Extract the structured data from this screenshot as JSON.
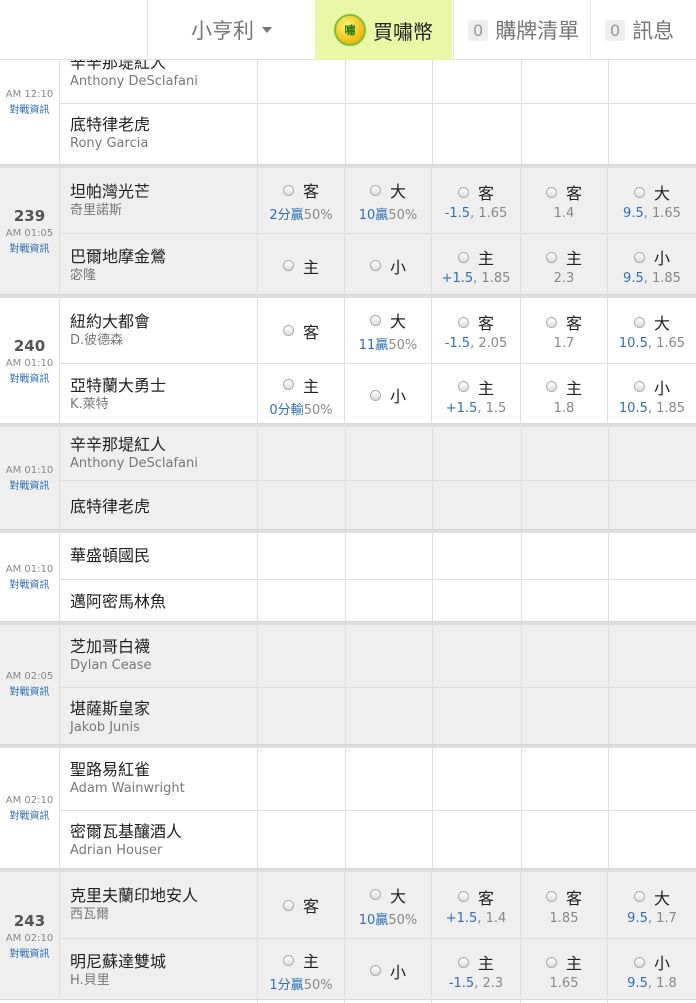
{
  "header": {
    "username": "小亨利",
    "coin_icon_text": "嘯",
    "buy_coin_label": "買嘯幣",
    "cart_count": "0",
    "cart_label": "購牌清單",
    "msg_count": "0",
    "msg_label": "訊息"
  },
  "games": [
    {
      "number": "",
      "time": "AM 12:10",
      "link": "對戰資訊",
      "gray": false,
      "clipped": true,
      "away": {
        "name": "辛辛那堤紅人",
        "sub": "Anthony DeSclafani"
      },
      "home": {
        "name": "底特律老虎",
        "sub": "Rony Garcia"
      },
      "odds": null
    },
    {
      "number": "239",
      "time": "AM 01:05",
      "link": "對戰資訊",
      "gray": true,
      "away": {
        "name": "坦帕灣光芒",
        "sub": "奇里諾斯"
      },
      "home": {
        "name": "巴爾地摩金鶯",
        "sub": "宓隆"
      },
      "odds": [
        {
          "away": {
            "label": "客",
            "hl": "2分贏",
            "rest": "50%"
          },
          "home": {
            "label": "主",
            "hl": "",
            "rest": ""
          }
        },
        {
          "away": {
            "label": "大",
            "hl": "10贏",
            "rest": "50%"
          },
          "home": {
            "label": "小",
            "hl": "",
            "rest": ""
          }
        },
        {
          "away": {
            "label": "客",
            "hl": "-1.5",
            "rest": ", 1.65"
          },
          "home": {
            "label": "主",
            "hl": "+1.5",
            "rest": ", 1.85"
          }
        },
        {
          "away": {
            "label": "客",
            "hl": "",
            "rest": "1.4"
          },
          "home": {
            "label": "主",
            "hl": "",
            "rest": "2.3"
          }
        },
        {
          "away": {
            "label": "大",
            "hl": "9.5",
            "rest": ", 1.65"
          },
          "home": {
            "label": "小",
            "hl": "9.5",
            "rest": ", 1.85"
          }
        }
      ]
    },
    {
      "number": "240",
      "time": "AM 01:10",
      "link": "對戰資訊",
      "gray": false,
      "away": {
        "name": "紐約大都會",
        "sub": "D.彼德森"
      },
      "home": {
        "name": "亞特蘭大勇士",
        "sub": "K.萊特"
      },
      "odds": [
        {
          "away": {
            "label": "客",
            "hl": "",
            "rest": ""
          },
          "home": {
            "label": "主",
            "hl": "0分輸",
            "rest": "50%"
          }
        },
        {
          "away": {
            "label": "大",
            "hl": "11贏",
            "rest": "50%"
          },
          "home": {
            "label": "小",
            "hl": "",
            "rest": ""
          }
        },
        {
          "away": {
            "label": "客",
            "hl": "-1.5",
            "rest": ", 2.05"
          },
          "home": {
            "label": "主",
            "hl": "+1.5",
            "rest": ", 1.5"
          }
        },
        {
          "away": {
            "label": "客",
            "hl": "",
            "rest": "1.7"
          },
          "home": {
            "label": "主",
            "hl": "",
            "rest": "1.8"
          }
        },
        {
          "away": {
            "label": "大",
            "hl": "10.5",
            "rest": ", 1.65"
          },
          "home": {
            "label": "小",
            "hl": "10.5",
            "rest": ", 1.85"
          }
        }
      ]
    },
    {
      "number": "",
      "time": "AM 01:10",
      "link": "對戰資訊",
      "gray": true,
      "away": {
        "name": "辛辛那堤紅人",
        "sub": "Anthony DeSclafani"
      },
      "home": {
        "name": "底特律老虎",
        "sub": ""
      },
      "odds": null
    },
    {
      "number": "",
      "time": "AM 01:10",
      "link": "對戰資訊",
      "gray": false,
      "away": {
        "name": "華盛頓國民",
        "sub": ""
      },
      "home": {
        "name": "邁阿密馬林魚",
        "sub": ""
      },
      "odds": null
    },
    {
      "number": "",
      "time": "AM 02:05",
      "link": "對戰資訊",
      "gray": true,
      "away": {
        "name": "芝加哥白襪",
        "sub": "Dylan Cease"
      },
      "home": {
        "name": "堪薩斯皇家",
        "sub": "Jakob Junis"
      },
      "odds": null
    },
    {
      "number": "",
      "time": "AM 02:10",
      "link": "對戰資訊",
      "gray": false,
      "away": {
        "name": "聖路易紅雀",
        "sub": "Adam Wainwright"
      },
      "home": {
        "name": "密爾瓦基釀酒人",
        "sub": "Adrian Houser"
      },
      "odds": null
    },
    {
      "number": "243",
      "time": "AM 02:10",
      "link": "對戰資訊",
      "gray": true,
      "away": {
        "name": "克里夫蘭印地安人",
        "sub": "西瓦爾"
      },
      "home": {
        "name": "明尼蘇達雙城",
        "sub": "H.貝里"
      },
      "odds": [
        {
          "away": {
            "label": "客",
            "hl": "",
            "rest": ""
          },
          "home": {
            "label": "主",
            "hl": "1分贏",
            "rest": "50%"
          }
        },
        {
          "away": {
            "label": "大",
            "hl": "10贏",
            "rest": "50%"
          },
          "home": {
            "label": "小",
            "hl": "",
            "rest": ""
          }
        },
        {
          "away": {
            "label": "客",
            "hl": "+1.5",
            "rest": ", 1.4"
          },
          "home": {
            "label": "主",
            "hl": "-1.5",
            "rest": ", 2.3"
          }
        },
        {
          "away": {
            "label": "客",
            "hl": "",
            "rest": "1.85"
          },
          "home": {
            "label": "主",
            "hl": "",
            "rest": "1.65"
          }
        },
        {
          "away": {
            "label": "大",
            "hl": "9.5",
            "rest": ", 1.7"
          },
          "home": {
            "label": "小",
            "hl": "9.5",
            "rest": ", 1.8"
          }
        }
      ]
    }
  ]
}
